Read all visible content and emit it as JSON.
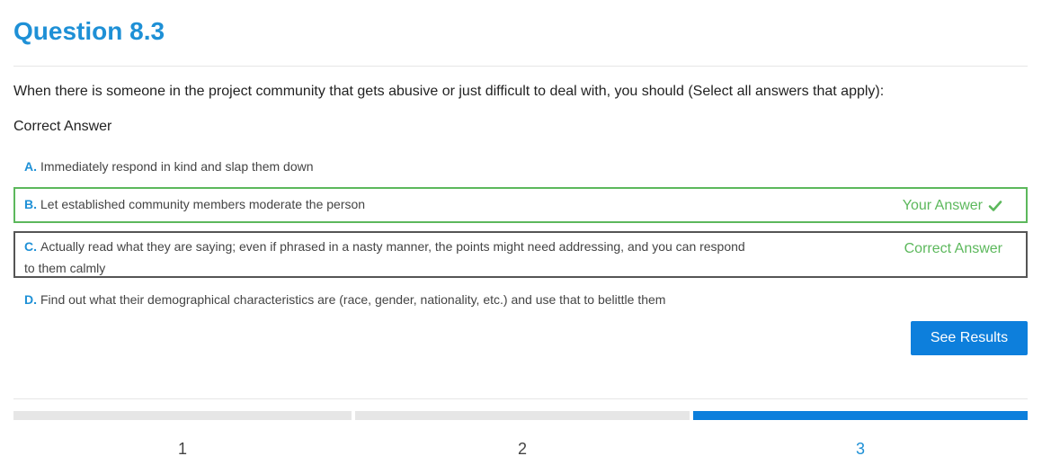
{
  "quiz": {
    "title": "Question 8.3",
    "question": "When there is someone in the project community that gets abusive or just difficult to deal with, you should (Select all answers that apply):",
    "status": "Correct Answer",
    "options": [
      {
        "letter": "A.",
        "text": "Immediately respond in kind and slap them down"
      },
      {
        "letter": "B.",
        "text": "Let established community members moderate the person",
        "tag": "Your Answer"
      },
      {
        "letter": "C.",
        "text": "Actually read what they are saying; even if phrased in a nasty manner, the points might need addressing, and you can respond to them calmly",
        "tag": "Correct Answer"
      },
      {
        "letter": "D.",
        "text": "Find out what their demographical characteristics are (race, gender, nationality, etc.) and use that to belittle them"
      }
    ],
    "see_results_label": "See Results"
  },
  "progress": {
    "steps": [
      {
        "label": "1"
      },
      {
        "label": "2"
      },
      {
        "label": "3"
      }
    ],
    "current": 3
  },
  "colors": {
    "accent": "#1e90d6",
    "button": "#0d7fdc",
    "success": "#5cb85c",
    "correct_border": "#555555"
  },
  "icons": {
    "your_answer": "check-icon"
  }
}
